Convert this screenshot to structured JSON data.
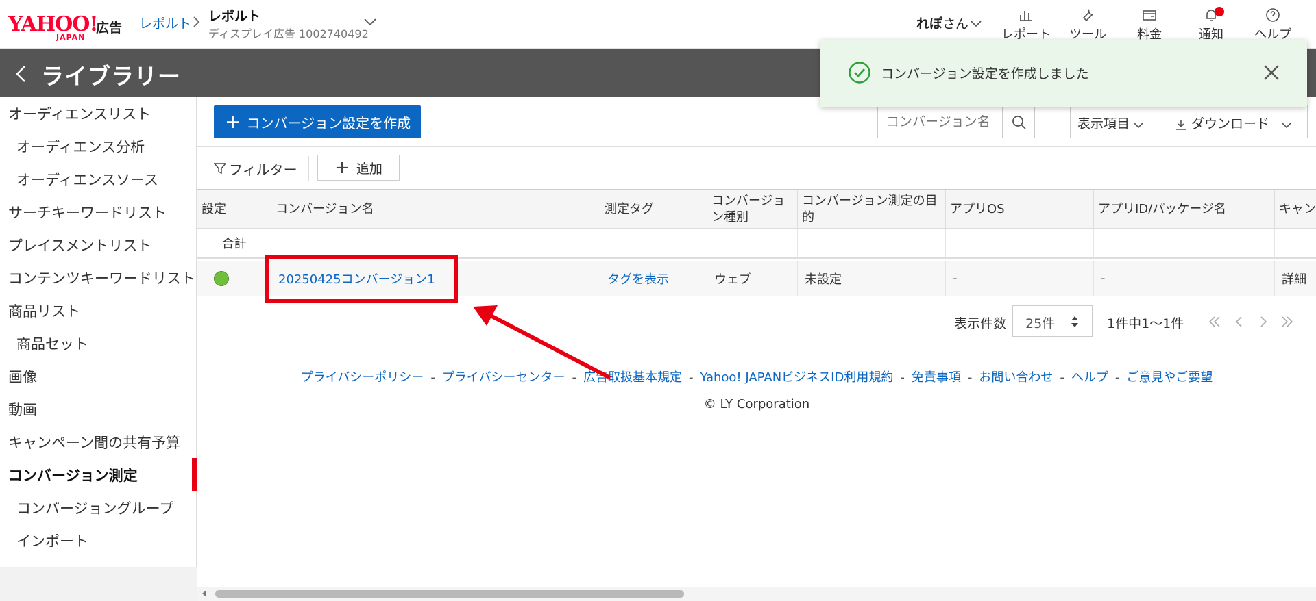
{
  "header": {
    "logo_text": "YAHOO!",
    "logo_sub": "JAPAN",
    "logo_ad": "広告",
    "breadcrumb_link": "レポルト",
    "breadcrumb_current": "レポルト",
    "breadcrumb_sub": "ディスプレイ広告 1002740492",
    "user_name": "れぽ",
    "user_suffix": "さん",
    "nav": [
      {
        "label": "レポート",
        "icon": "bar-chart-icon"
      },
      {
        "label": "ツール",
        "icon": "wrench-icon"
      },
      {
        "label": "料金",
        "icon": "wallet-icon"
      },
      {
        "label": "通知",
        "icon": "bell-icon"
      },
      {
        "label": "ヘルプ",
        "icon": "help-icon"
      }
    ]
  },
  "titlebar": {
    "title": "ライブラリー"
  },
  "sidebar": {
    "items": [
      {
        "label": "オーディエンスリスト"
      },
      {
        "label": "オーディエンス分析"
      },
      {
        "label": "オーディエンスソース"
      },
      {
        "label": "サーチキーワードリスト"
      },
      {
        "label": "プレイスメントリスト"
      },
      {
        "label": "コンテンツキーワードリスト"
      },
      {
        "label": "商品リスト"
      },
      {
        "label": "商品セット"
      },
      {
        "label": "画像"
      },
      {
        "label": "動画"
      },
      {
        "label": "キャンペーン間の共有予算"
      },
      {
        "label": "コンバージョン測定"
      },
      {
        "label": "コンバージョングループ"
      },
      {
        "label": "インポート"
      }
    ]
  },
  "toolbar": {
    "create_label": "コンバージョン設定を作成",
    "search_placeholder": "コンバージョン名",
    "columns_label": "表示項目",
    "download_label": "ダウンロード",
    "filter_label": "フィルター",
    "add_label": "追加"
  },
  "table": {
    "headers": [
      "設定",
      "コンバージョン名",
      "測定タグ",
      "コンバージョン種別",
      "コンバージョン測定の目的",
      "アプリOS",
      "アプリID/パッケージ名",
      "キャン"
    ],
    "total_label": "合計",
    "rows": [
      {
        "name": "20250425コンバージョン1",
        "tag": "タグを表示",
        "type": "ウェブ",
        "purpose": "未設定",
        "os": "-",
        "app_id": "-",
        "detail": "詳細"
      }
    ]
  },
  "pagination": {
    "label": "表示件数",
    "page_size": "25件",
    "range": "1件中1～1件"
  },
  "footer": {
    "links": [
      "プライバシーポリシー",
      "プライバシーセンター",
      "広告取扱基本規定",
      "Yahoo! JAPANビジネスID利用規約",
      "免責事項",
      "お問い合わせ",
      "ヘルプ",
      "ご意見やご要望"
    ],
    "copyright": "© LY Corporation"
  },
  "toast": {
    "message": "コンバージョン設定を作成しました"
  },
  "colors": {
    "brand": "#ff0033",
    "accent": "#0b67c2",
    "success": "#2e9e3a",
    "annotation": "#e60012"
  }
}
